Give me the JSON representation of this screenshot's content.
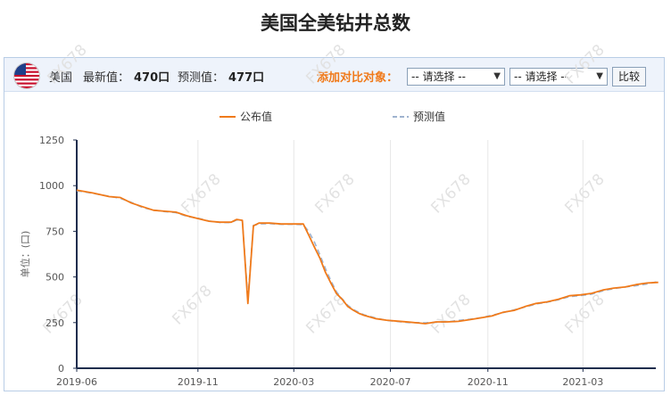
{
  "title": "美国全美钻井总数",
  "toolbar": {
    "country": "美国",
    "latest_label": "最新值：",
    "latest_value": "470口",
    "forecast_label": "预测值：",
    "forecast_value": "477口",
    "compare_label": "添加对比对象：",
    "select1": "-- 请选择 --",
    "select2": "-- 请选择 --",
    "compare_button": "比较"
  },
  "watermark": "FX678",
  "chart_data": {
    "type": "line",
    "ylabel": "单位：(口)",
    "ylim": [
      0,
      1250
    ],
    "yticks": [
      0,
      250,
      500,
      750,
      1000,
      1250
    ],
    "xlim": [
      "2019-06",
      "2021-06"
    ],
    "xticks": [
      "2019-06",
      "2019-11",
      "2020-03",
      "2020-07",
      "2020-11",
      "2021-03"
    ],
    "legend_position": "top-center",
    "series": [
      {
        "name": "公布值",
        "color": "#f07a1a",
        "dash": "solid",
        "x": [
          "2019-06-01",
          "2019-06-21",
          "2019-07-12",
          "2019-07-26",
          "2019-08-09",
          "2019-08-23",
          "2019-09-06",
          "2019-09-20",
          "2019-10-04",
          "2019-10-18",
          "2019-11-01",
          "2019-11-15",
          "2019-11-29",
          "2019-12-13",
          "2019-12-20",
          "2019-12-27",
          "2020-01-03",
          "2020-01-10",
          "2020-01-17",
          "2020-01-31",
          "2020-02-14",
          "2020-02-28",
          "2020-03-13",
          "2020-03-20",
          "2020-03-27",
          "2020-04-03",
          "2020-04-10",
          "2020-04-17",
          "2020-04-24",
          "2020-05-01",
          "2020-05-08",
          "2020-05-15",
          "2020-05-22",
          "2020-05-29",
          "2020-06-12",
          "2020-06-26",
          "2020-07-10",
          "2020-07-24",
          "2020-08-07",
          "2020-08-14",
          "2020-08-28",
          "2020-09-11",
          "2020-09-25",
          "2020-10-09",
          "2020-10-23",
          "2020-11-06",
          "2020-11-20",
          "2020-12-04",
          "2020-12-18",
          "2021-01-01",
          "2021-01-15",
          "2021-01-29",
          "2021-02-12",
          "2021-02-26",
          "2021-03-12",
          "2021-03-26",
          "2021-04-09",
          "2021-04-23",
          "2021-05-07",
          "2021-05-21",
          "2021-06-04"
        ],
        "y": [
          975,
          960,
          940,
          935,
          905,
          885,
          865,
          860,
          855,
          835,
          820,
          805,
          800,
          800,
          815,
          810,
          355,
          780,
          795,
          795,
          790,
          790,
          790,
          728,
          664,
          602,
          525,
          465,
          408,
          378,
          339,
          318,
          301,
          289,
          272,
          263,
          258,
          253,
          247,
          244,
          254,
          254,
          257,
          266,
          276,
          286,
          306,
          317,
          338,
          355,
          364,
          378,
          397,
          402,
          410,
          428,
          439,
          445,
          458,
          467,
          470
        ]
      },
      {
        "name": "预测值",
        "color": "#9fb3cf",
        "dash": "dashed",
        "x": [
          "2019-06-01",
          "2019-06-21",
          "2019-07-12",
          "2019-07-26",
          "2019-08-09",
          "2019-08-23",
          "2019-09-06",
          "2019-09-20",
          "2019-10-04",
          "2019-10-18",
          "2019-11-01",
          "2019-11-15",
          "2019-11-29",
          "2019-12-13",
          "2019-12-20",
          "2019-12-27",
          "2020-01-03",
          "2020-01-10",
          "2020-01-17",
          "2020-01-31",
          "2020-02-14",
          "2020-02-28",
          "2020-03-13",
          "2020-03-20",
          "2020-03-27",
          "2020-04-03",
          "2020-04-10",
          "2020-04-17",
          "2020-04-24",
          "2020-05-01",
          "2020-05-08",
          "2020-05-15",
          "2020-05-22",
          "2020-05-29",
          "2020-06-12",
          "2020-06-26",
          "2020-07-10",
          "2020-07-24",
          "2020-08-07",
          "2020-08-14",
          "2020-08-28",
          "2020-09-11",
          "2020-09-25",
          "2020-10-09",
          "2020-10-23",
          "2020-11-06",
          "2020-11-20",
          "2020-12-04",
          "2020-12-18",
          "2021-01-01",
          "2021-01-15",
          "2021-01-29",
          "2021-02-12",
          "2021-02-26",
          "2021-03-12",
          "2021-03-26",
          "2021-04-09",
          "2021-04-23",
          "2021-05-07",
          "2021-05-21",
          "2021-06-04"
        ],
        "y": [
          972,
          958,
          942,
          930,
          908,
          880,
          866,
          858,
          852,
          832,
          822,
          806,
          798,
          798,
          812,
          808,
          380,
          782,
          790,
          792,
          788,
          788,
          786,
          748,
          692,
          620,
          545,
          478,
          418,
          380,
          345,
          322,
          306,
          292,
          276,
          262,
          256,
          250,
          250,
          249,
          252,
          254,
          262,
          268,
          277,
          290,
          304,
          320,
          335,
          352,
          362,
          375,
          392,
          398,
          406,
          424,
          436,
          445,
          452,
          462,
          475
        ]
      }
    ]
  }
}
